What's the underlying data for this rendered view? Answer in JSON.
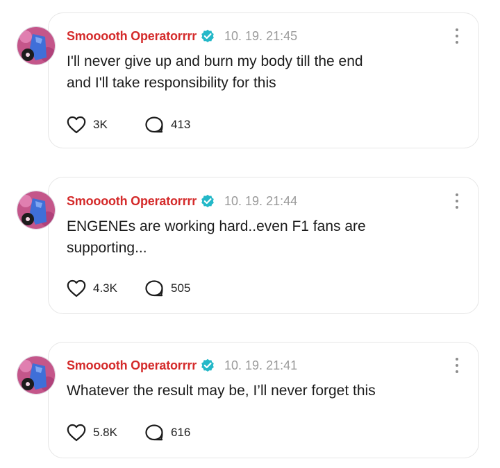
{
  "colors": {
    "author": "#d42a2a",
    "verified": "#24b8c8",
    "timestamp": "#9a9a9a",
    "card_border": "#e6e6e6"
  },
  "posts": [
    {
      "author": "Smooooth Operatorrrr",
      "verified_icon": "verified-badge-icon",
      "timestamp": "10. 19. 21:45",
      "lines": [
        "I'll never give up and burn my body till the end",
        "and I'll take responsibility for this"
      ],
      "likes": "3K",
      "comments": "413"
    },
    {
      "author": "Smooooth Operatorrrr",
      "verified_icon": "verified-badge-icon",
      "timestamp": "10. 19. 21:44",
      "lines": [
        "ENGENEs are working hard..even F1 fans are",
        "supporting..."
      ],
      "likes": "4.3K",
      "comments": "505"
    },
    {
      "author": "Smooooth Operatorrrr",
      "verified_icon": "verified-badge-icon",
      "timestamp": "10. 19. 21:41",
      "lines": [
        "Whatever the result may be, I’ll never forget this"
      ],
      "likes": "5.8K",
      "comments": "616"
    }
  ]
}
